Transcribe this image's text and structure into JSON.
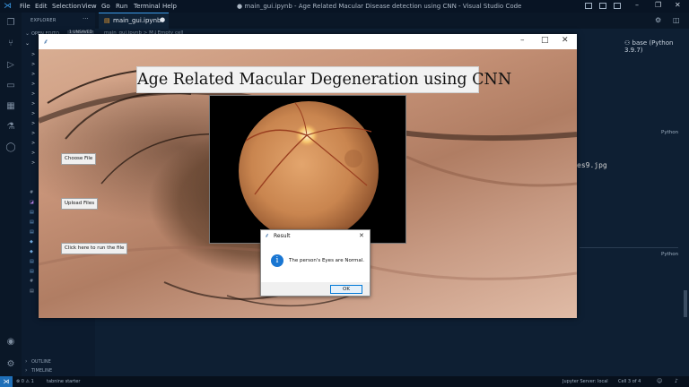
{
  "vscode": {
    "menu": [
      "File",
      "Edit",
      "Selection",
      "View",
      "Go",
      "Run",
      "Terminal",
      "Help"
    ],
    "window_title": "● main_gui.ipynb - Age Related Macular Disease detection using CNN - Visual Studio Code",
    "sidebar": {
      "header": "EXPLORER",
      "open_editors": "OPEN EDITO...",
      "unsaved_badge": "1 UNSAVED",
      "outline": "OUTLINE",
      "timeline": "TIMELINE"
    },
    "tab": {
      "label": "main_gui.ipynb"
    },
    "breadcrumb": "main_gui.ipynb > M↓Empty cell",
    "kernel": "base (Python 3.9.7)",
    "editor": {
      "python_label_1": "Python",
      "python_label_2": "Python",
      "code_fragment": "es9.jpg"
    },
    "status": {
      "errors": "⊗ 0 ⚠ 1",
      "tabnine": "tabnine starter",
      "jupyter": "Jupyter Server: local",
      "cell": "Cell 3 of 4"
    }
  },
  "app_window": {
    "title": "Age Related Macular Degeneration using CNN",
    "buttons": {
      "choose": "Choose File",
      "upload": "Upload Files",
      "run": "Click here to run the file"
    }
  },
  "dialog": {
    "title": "Result",
    "message": "The person's Eyes are Normal.",
    "ok": "OK"
  },
  "colors": {
    "vscode_bg": "#0e1f33",
    "accent": "#3b9be8",
    "dialog_ok_border": "#0078d7",
    "info_icon": "#1976d2"
  }
}
